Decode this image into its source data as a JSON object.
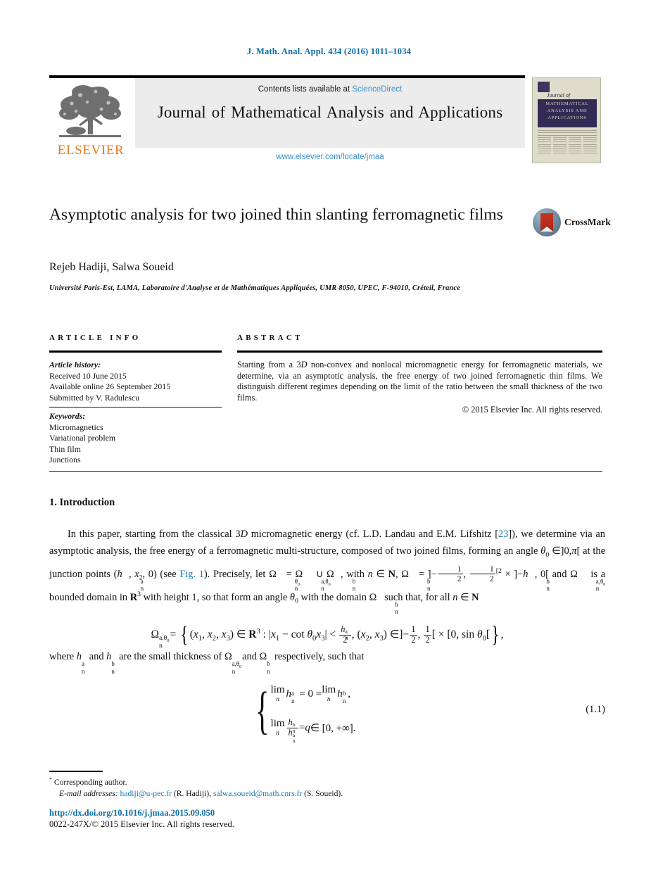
{
  "running_head": "J. Math. Anal. Appl. 434 (2016) 1011–1034",
  "masthead": {
    "contents_prefix": "Contents lists available at ",
    "sciencedirect": "ScienceDirect",
    "journal_title": "Journal of Mathematical Analysis and Applications",
    "url": "www.elsevier.com/locate/jmaa",
    "publisher_wordmark": "ELSEVIER"
  },
  "cover": {
    "script": "Journal of",
    "line1": "MATHEMATICAL",
    "line2": "ANALYSIS AND",
    "line3": "APPLICATIONS"
  },
  "article": {
    "title": "Asymptotic analysis for two joined thin slanting ferromagnetic films",
    "authors": "Rejeb Hadiji, Salwa Soueid",
    "corresponding_marker": "*",
    "affiliation": "Université Paris-Est, LAMA, Laboratoire d'Analyse et de Mathématiques Appliquées, UMR 8050, UPEC, F-94010, Créteil, France",
    "crossmark_label": "CrossMark"
  },
  "info": {
    "heading": "ARTICLE INFO",
    "history_label": "Article history:",
    "received": "Received 10 June 2015",
    "available_online": "Available online 26 September 2015",
    "submitted_by": "Submitted by V. Radulescu",
    "keywords_label": "Keywords:",
    "keywords": [
      "Micromagnetics",
      "Variational problem",
      "Thin film",
      "Junctions"
    ]
  },
  "abstract": {
    "heading": "ABSTRACT",
    "text_part1": "Starting from a 3",
    "text_italic_D": "D",
    "text_part2": " non-convex and nonlocal micromagnetic energy for ferromagnetic materials, we determine, via an asymptotic analysis, the free energy of two joined ferromagnetic thin films. We distinguish different regimes depending on the limit of the ratio between the small thickness of the two films.",
    "copyright": "© 2015 Elsevier Inc. All rights reserved."
  },
  "body": {
    "section_heading": "1.  Introduction",
    "p1_a": "In this paper, starting from the classical 3",
    "p1_D": "D",
    "p1_b": " micromagnetic energy (cf. L.D. Landau and E.M. Lifshitz [",
    "p1_ref": "23",
    "p1_c": "]), we determine via an asymptotic analysis, the free energy of a ferromagnetic multi-structure, composed of two joined films, forming an angle ",
    "p1_d": " at the junction points ",
    "p1_e": " (see ",
    "p1_figref": "Fig. 1",
    "p1_f": ").",
    "p2_lead": "Precisely, let",
    "p2_mid": "with",
    "p2_tail": "is a bounded domain in",
    "p2_line3": "with height 1, so that form an angle",
    "p2_line3b": "with the domain",
    "p2_line3c": "such that, for all",
    "where_line": "where",
    "where_mid": "and",
    "where_tail": "are the small thickness of",
    "where_tail2": "and",
    "where_end": "respectively, such that",
    "eq_number": "(1.1)"
  },
  "footer": {
    "corresponding": "Corresponding author.",
    "email_label": "E-mail addresses:",
    "email1": "hadiji@u-pec.fr",
    "email1_owner": "(R. Hadiji),",
    "email2": "salwa.soueid@math.cnrs.fr",
    "email2_owner": "(S. Soueid).",
    "doi": "http://dx.doi.org/10.1016/j.jmaa.2015.09.050",
    "issn": "0022-247X/© 2015 Elsevier Inc. All rights reserved."
  },
  "colors": {
    "link_blue": "#1a7ab5",
    "header_blue": "#0b6ca8",
    "sciencedirect_blue": "#3a8fc8",
    "elsevier_orange": "#e87a1e",
    "cover_navy": "#322c55",
    "cover_cream": "#dedccb"
  }
}
